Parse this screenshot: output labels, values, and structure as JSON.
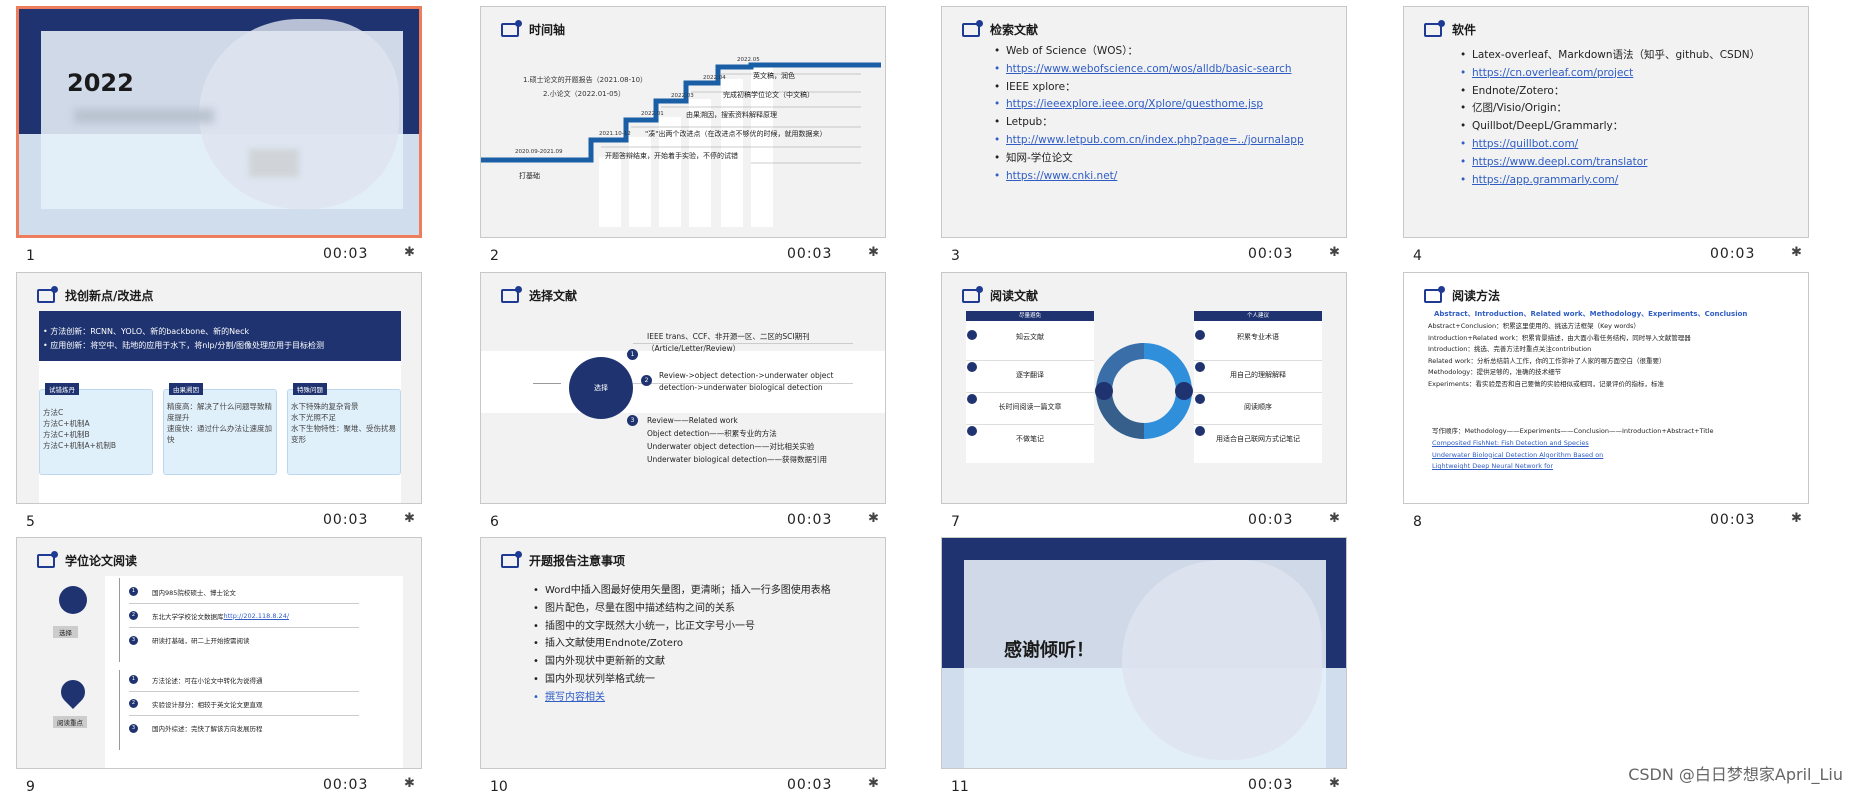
{
  "slides": [
    {
      "num": "1",
      "duration": "00:03",
      "year": "2022"
    },
    {
      "num": "2",
      "duration": "00:03",
      "title": "时间轴",
      "legend": [
        "1.硕士论文的开题报告（2021.08-10）",
        "2.小论文（2022.01-05）"
      ],
      "steps": [
        {
          "date": "2020.09-2021.09",
          "text": "打基础"
        },
        {
          "date": "2021.10-12",
          "text": "开题答辩结束，开始着手实验，不停的试错"
        },
        {
          "date": "2022.01",
          "text": "\"凑\"出两个改进点（在改进点不够优的时候，就用数据来）"
        },
        {
          "date": "2022.03",
          "text": "由果溯因，搜索资料解释原理"
        },
        {
          "date": "2022.04",
          "text": "完成初稿学位论文（中文稿）"
        },
        {
          "date": "2022.05",
          "text": "英文稿，润色"
        }
      ]
    },
    {
      "num": "3",
      "duration": "00:03",
      "title": "检索文献",
      "items": [
        "Web of Science（WOS）：",
        "https://www.webofscience.com/wos/alldb/basic-search",
        "IEEE xplore：",
        "https://ieeexplore.ieee.org/Xplore/guesthome.jsp",
        "Letpub：",
        "http://www.letpub.com.cn/index.php?page=../journalapp",
        "知网-学位论文",
        "https://www.cnki.net/"
      ]
    },
    {
      "num": "4",
      "duration": "00:03",
      "title": "软件",
      "items": [
        "Latex-overleaf、Markdown语法（知乎、github、CSDN）",
        "https://cn.overleaf.com/project",
        "Endnote/Zotero：",
        "亿图/Visio/Origin：",
        "Quillbot/DeepL/Grammarly：",
        "https://quillbot.com/",
        "https://www.deepl.com/translator",
        "https://app.grammarly.com/"
      ]
    },
    {
      "num": "5",
      "duration": "00:03",
      "title": "找创新点/改进点",
      "banner": [
        "• 方法创新：RCNN、YOLO、新的backbone、新的Neck",
        "• 应用创新：将空中、陆地的应用于水下，将nlp/分割/图像处理应用于目标检测"
      ],
      "cards": [
        {
          "tag": "试错炼丹",
          "text": [
            "方法C",
            "方法C+机制A",
            "方法C+机制B",
            "方法C+机制A+机制B"
          ]
        },
        {
          "tag": "由果溯因",
          "text": [
            "精度高：解决了什么问题导致精度提升",
            "速度快：通过什么办法让速度加快"
          ]
        },
        {
          "tag": "特殊问题",
          "text": [
            "水下特殊的复杂背景",
            "水下光照不足",
            "水下生物特性：聚堆、受伤扰易变形"
          ]
        }
      ]
    },
    {
      "num": "6",
      "duration": "00:03",
      "title": "选择文献",
      "center": "选择",
      "items": [
        {
          "n": "1",
          "text": "IEEE trans、CCF、非开源一区、二区的SCI期刊（Article/Letter/Review）"
        },
        {
          "n": "2",
          "text": "Review->object detection->underwater object detection->underwater biological detection"
        },
        {
          "n": "3",
          "lines": [
            "Review——Related work",
            "Object detection——积累专业的方法",
            "Underwater object detection——对比相关实验",
            "Underwater biological detection——获得数据引用"
          ]
        }
      ]
    },
    {
      "num": "7",
      "duration": "00:03",
      "title": "阅读文献",
      "left_header": "尽量避免",
      "right_header": "个人建议",
      "left": [
        "知云文献",
        "逐字翻译",
        "长时间阅读一篇文章",
        "不做笔记"
      ],
      "right": [
        "积累专业术语",
        "用自己的理解解释",
        "阅读顺序",
        "用适合自己联网方式记笔记"
      ]
    },
    {
      "num": "8",
      "duration": "00:03",
      "title": "阅读方法",
      "heading": "Abstract、Introduction、Related work、Methodology、Experiments、Conclusion",
      "items": [
        "Abstract+Conclusion：积累这里使用的、挑选方法框架（Key words）",
        "Introduction+Related work：积累背景描述，由大面小看任务结构，同时导入文献管理器",
        "Introduction：挑选、完善方法时重点关注contribution",
        "Related work：分析总结前人工作，你的工作弥补了人家的哪方面空白（很重要）",
        "Methodology：提供足够的，准确的技术细节",
        "Experiments：看实验是否和自己要做的实验相似或相同，记录评价的指标，标准"
      ],
      "order": "写作顺序：Methodology——Experiments——Conclusion——Introduction+Abstract+Title",
      "links": [
        "Composited FishNet: Fish Detection and Species",
        "Underwater Biological Detection Algorithm Based on",
        "Lightweight Deep Neural Network for"
      ]
    },
    {
      "num": "9",
      "duration": "00:03",
      "title": "学位论文阅读",
      "badge1": "选择",
      "badge2": "阅读重点",
      "top": [
        {
          "n": "1",
          "text": "国内985院校硕士、博士论文"
        },
        {
          "n": "2",
          "text": "东北大学学校论文数据库",
          "link": "http://202.118.8.24/"
        },
        {
          "n": "3",
          "text": "研读打基础，研二上开始按需阅读"
        }
      ],
      "bottom": [
        {
          "n": "1",
          "text": "方法论述：可在小论文中转化为说得通"
        },
        {
          "n": "2",
          "text": "实验设计部分：相较于英文论文更直观"
        },
        {
          "n": "3",
          "text": "国内外综述：完快了解该方向发展历程"
        }
      ]
    },
    {
      "num": "10",
      "duration": "00:03",
      "title": "开题报告注意事项",
      "items": [
        "Word中插入图最好使用矢量图，更清晰；插入一行多图使用表格",
        "图片配色，尽量在图中描述结构之间的关系",
        "插图中的文字既然大小统一，比正文字号小一号",
        "插入文献使用Endnote/Zotero",
        "国内外现状中更新新的文献",
        "国内外现状列举格式统一"
      ],
      "link": "撰写内容相关"
    },
    {
      "num": "11",
      "duration": "00:03",
      "thanks": "感谢倾听！"
    }
  ],
  "watermark": "CSDN @白日梦想家April_Liu"
}
